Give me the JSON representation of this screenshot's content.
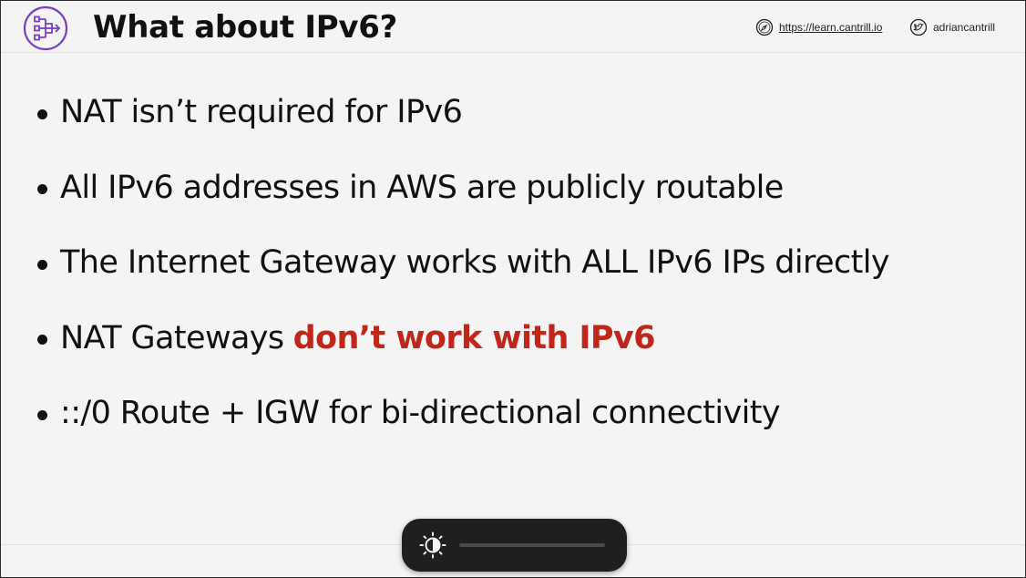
{
  "slide": {
    "title": "What about IPv6?",
    "header_links": {
      "site": {
        "icon": "compass-icon",
        "text": "https://learn.cantrill.io"
      },
      "social": {
        "icon": "twitter-icon",
        "text": "adriancantrill"
      }
    },
    "logo_icon": "nat-gateway-icon",
    "accent_color": "#7b3fbf",
    "emphasis_color": "#c0261a",
    "bullets": [
      {
        "text": "NAT isn’t required for IPv6",
        "emphasis": ""
      },
      {
        "text": "All IPv6 addresses in AWS are publicly routable",
        "emphasis": ""
      },
      {
        "text": "The Internet Gateway works with ALL IPv6 IPs directly",
        "emphasis": ""
      },
      {
        "text": "NAT Gateways",
        "emphasis": "don’t work with IPv6"
      },
      {
        "text": "::/0 Route + IGW for bi-directional connectivity",
        "emphasis": ""
      }
    ]
  },
  "brightness_overlay": {
    "icon": "brightness-icon",
    "level": 0
  }
}
